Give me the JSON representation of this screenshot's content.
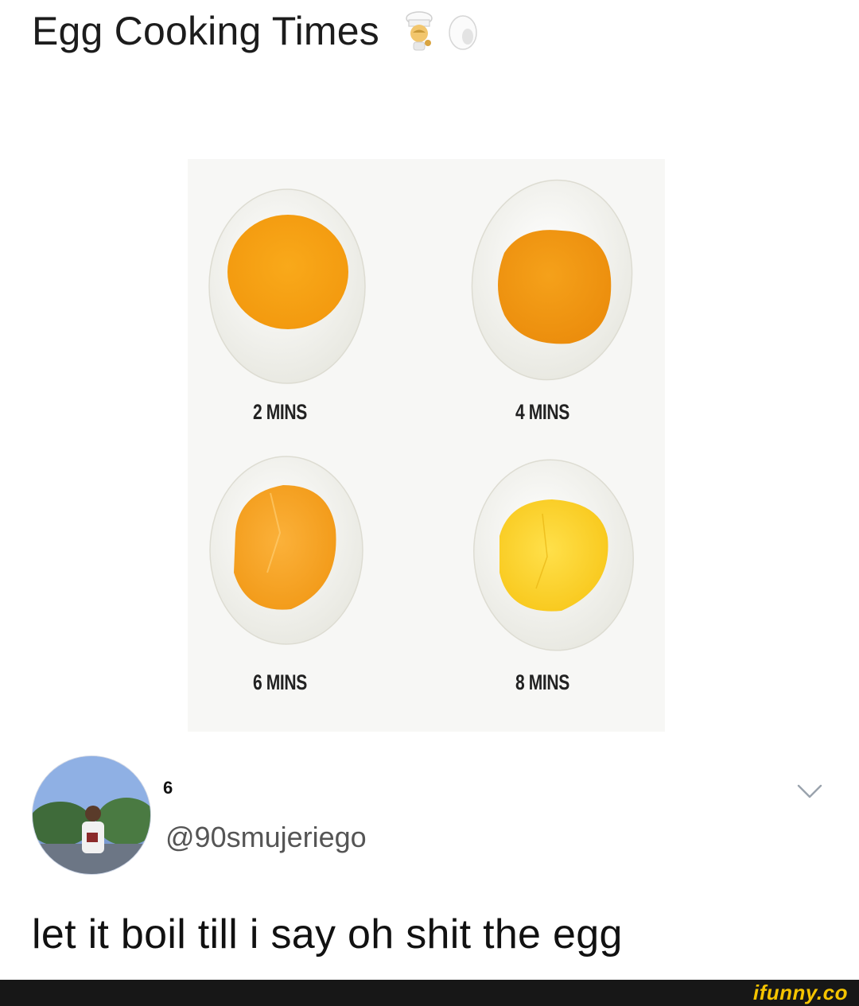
{
  "post": {
    "title": "Egg Cooking Times",
    "title_emojis": [
      "chef-emoji",
      "egg-emoji"
    ]
  },
  "eggs": [
    {
      "label": "2 MINS",
      "yolk": "#f4a012",
      "white": "#f3f3ee"
    },
    {
      "label": "4 MINS",
      "yolk": "#f0960f",
      "white": "#f3f3ee"
    },
    {
      "label": "6 MINS",
      "yolk": "#f5a623",
      "white": "#f3f3ee"
    },
    {
      "label": "8 MINS",
      "yolk": "#fcd22a",
      "white": "#f3f3ee"
    }
  ],
  "tweet": {
    "user_number": "6",
    "handle": "@90smujeriego",
    "text": "let it boil till i say oh shit the egg"
  },
  "footer": {
    "logo": "ifunny.co",
    "logo_color": "#f5c400"
  }
}
